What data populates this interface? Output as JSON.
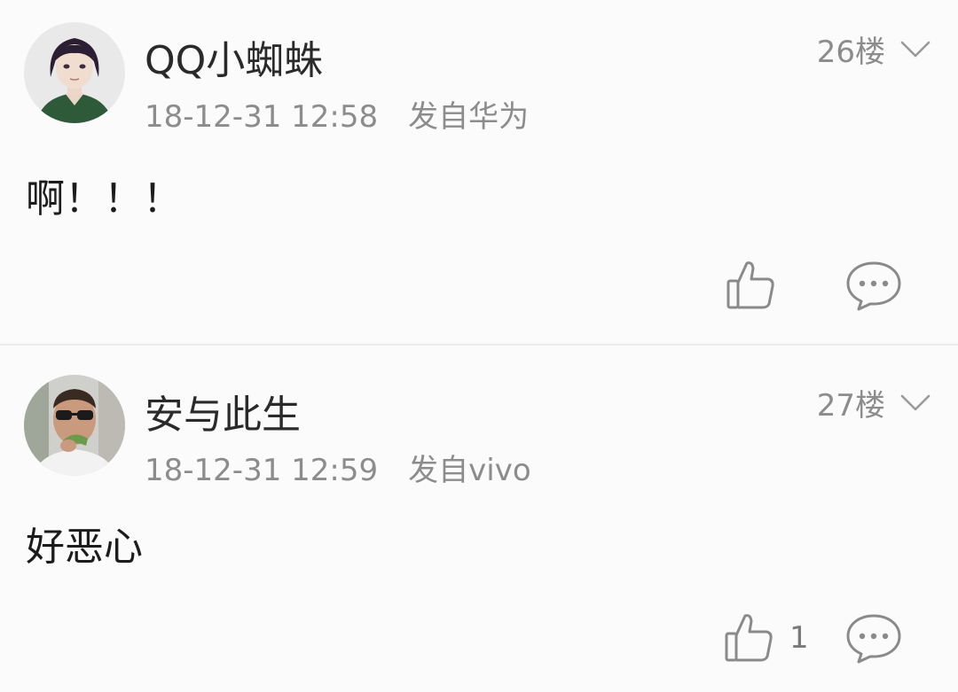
{
  "comments": [
    {
      "username": "QQ小蜘蛛",
      "time": "18-12-31 12:58",
      "source": "发自华为",
      "floor": "26楼",
      "content": "啊！！！",
      "likes": "",
      "avatar_icon": "cartoon-girl-avatar"
    },
    {
      "username": "安与此生",
      "time": "18-12-31 12:59",
      "source": "发自vivo",
      "floor": "27楼",
      "content": "好恶心",
      "likes": "1",
      "avatar_icon": "man-sunglasses-avatar"
    }
  ],
  "icons": {
    "like": "thumbs-up-icon",
    "reply": "speech-bubble-icon",
    "menu": "chevron-down-icon"
  },
  "colors": {
    "background": "#fcfbfc",
    "text_primary": "#222222",
    "text_secondary": "#8c8c8c",
    "divider": "#ececec"
  }
}
